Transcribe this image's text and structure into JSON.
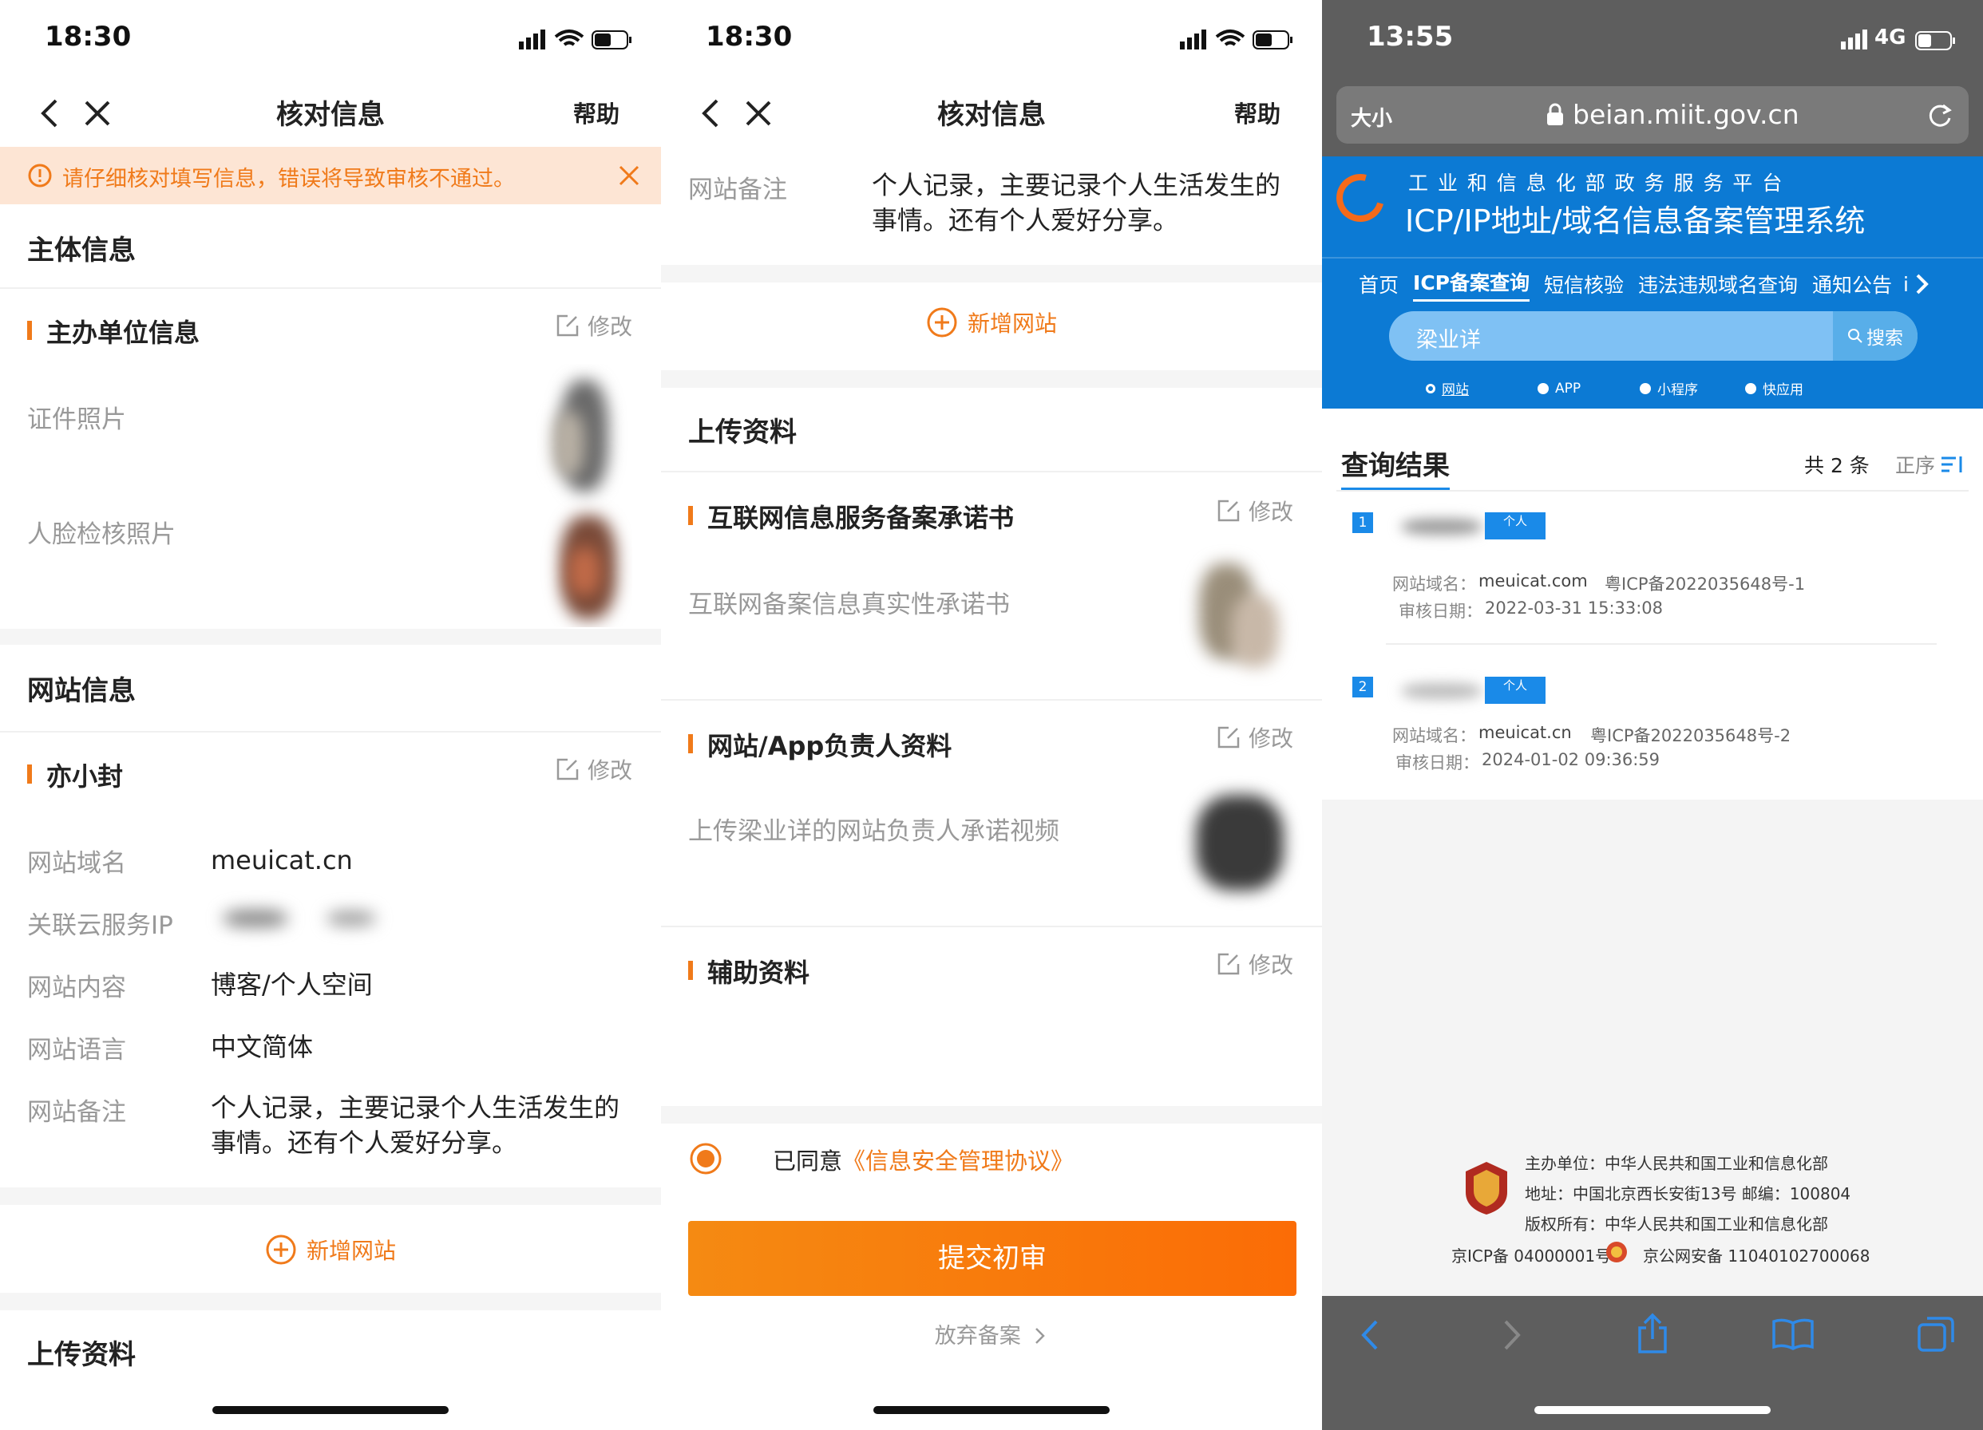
{
  "p1": {
    "time": "18:30",
    "nav_title": "核对信息",
    "help": "帮助",
    "warning": "请仔细核对填写信息，错误将导致审核不通过。",
    "sec_subject": "主体信息",
    "sub_org": "主办单位信息",
    "edit": "修改",
    "lbl_cert": "证件照片",
    "lbl_face": "人脸检核照片",
    "sec_site": "网站信息",
    "sub_site_name": "亦小封",
    "rows": [
      {
        "label": "网站域名",
        "value": "meuicat.cn"
      },
      {
        "label": "关联云服务IP",
        "value": ""
      },
      {
        "label": "网站内容",
        "value": "博客/个人空间"
      },
      {
        "label": "网站语言",
        "value": "中文简体"
      },
      {
        "label": "网站备注",
        "value": "个人记录，主要记录个人生活发生的事情。还有个人爱好分享。"
      }
    ],
    "add_site": "新增网站",
    "sec_upload": "上传资料"
  },
  "p2": {
    "time": "18:30",
    "nav_title": "核对信息",
    "help": "帮助",
    "note_label": "网站备注",
    "note_value": "个人记录，主要记录个人生活发生的事情。还有个人爱好分享。",
    "add_site": "新增网站",
    "sec_upload": "上传资料",
    "items": [
      {
        "title": "互联网信息服务备案承诺书",
        "desc": "互联网备案信息真实性承诺书"
      },
      {
        "title": "网站/App负责人资料",
        "desc": "上传梁业详的网站负责人承诺视频"
      },
      {
        "title": "辅助资料",
        "desc": ""
      }
    ],
    "edit": "修改",
    "agree_prefix": "已同意",
    "agree_link": "《信息安全管理协议》",
    "submit": "提交初审",
    "abandon": "放弃备案"
  },
  "p3": {
    "time": "13:55",
    "network": "4G",
    "size_btn": "大小",
    "url": "beian.miit.gov.cn",
    "header_top": "工 业 和 信 息 化 部 政 务 服 务 平 台",
    "header_main": "ICP/IP地址/域名信息备案管理系统",
    "menu": [
      "首页",
      "ICP备案查询",
      "短信核验",
      "违法违规域名查询",
      "通知公告",
      "i"
    ],
    "search_value": "梁业详",
    "search_btn": "搜索",
    "radios": [
      "网站",
      "APP",
      "小程序",
      "快应用"
    ],
    "results_title": "查询结果",
    "total": "共 2 条",
    "sort": "正序",
    "results": [
      {
        "idx": "1",
        "tag": "个人",
        "domain_label": "网站域名：",
        "domain": "meuicat.com",
        "icp": "粤ICP备2022035648号-1",
        "date_label": "审核日期：",
        "date": "2022-03-31 15:33:08"
      },
      {
        "idx": "2",
        "tag": "个人",
        "domain_label": "网站域名：",
        "domain": "meuicat.cn",
        "icp": "粤ICP备2022035648号-2",
        "date_label": "审核日期：",
        "date": "2024-01-02 09:36:59"
      }
    ],
    "footer": [
      "主办单位：中华人民共和国工业和信息化部",
      "地址：中国北京西长安街13号 邮编：100804",
      "版权所有：中华人民共和国工业和信息化部"
    ],
    "footer_icp": "京ICP备 04000001号",
    "footer_police": "京公网安备 11040102700068",
    "colors": {
      "orange": "#f07a1a",
      "blue": "#1a8ae8",
      "toolbar": "#5e5e5e"
    }
  }
}
